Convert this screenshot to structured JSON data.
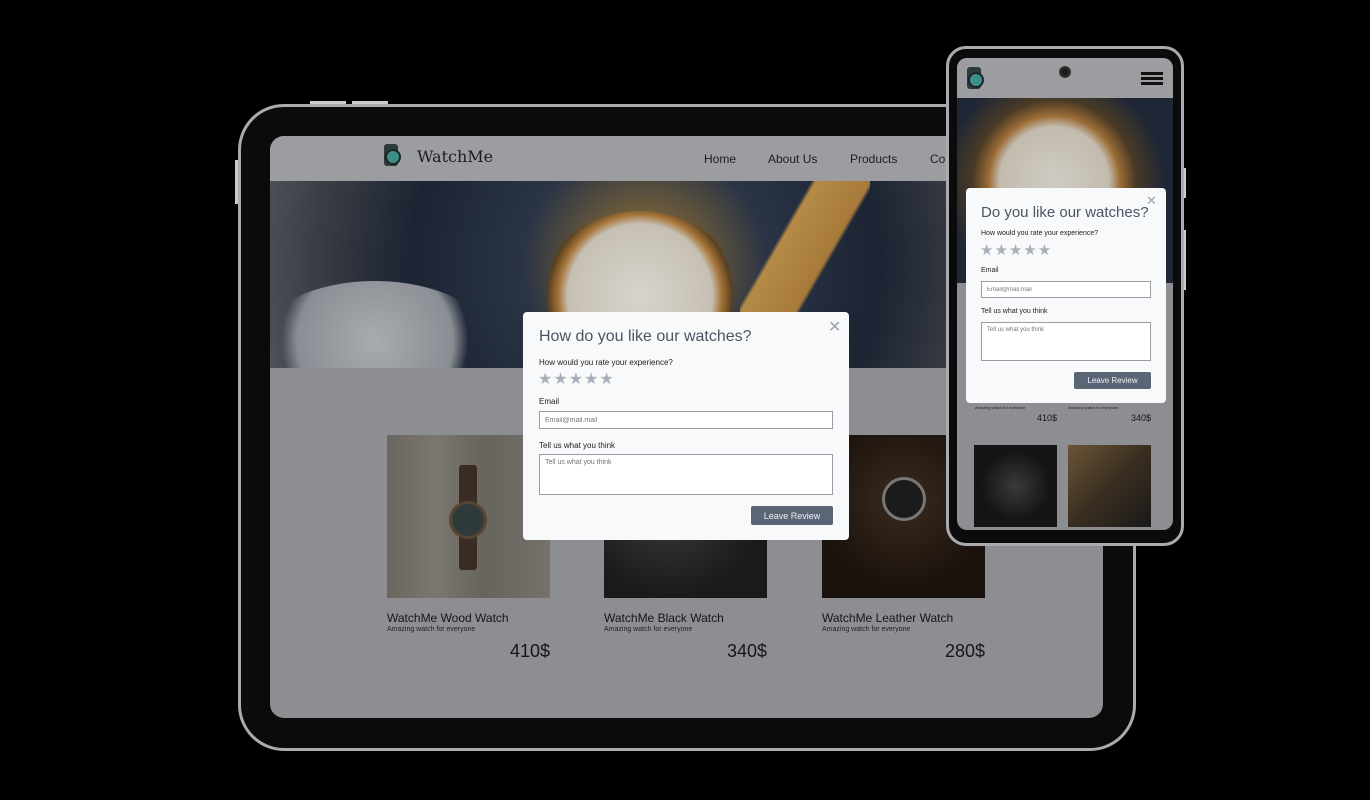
{
  "site": {
    "brand": "WatchMe",
    "nav": [
      "Home",
      "About Us",
      "Products",
      "Co"
    ]
  },
  "products": [
    {
      "title": "WatchMe Wood Watch",
      "subtitle": "Amazing watch for everyone",
      "price": "410$"
    },
    {
      "title": "WatchMe Black Watch",
      "subtitle": "Amazing watch for everyone",
      "price": "340$"
    },
    {
      "title": "WatchMe Leather Watch",
      "subtitle": "Amazing watch for everyone",
      "price": "280$"
    }
  ],
  "tablet_modal": {
    "title": "How do you like our watches?",
    "rating_label": "How would you rate your experience?",
    "stars": "★★★★★",
    "email_label": "Email",
    "email_placeholder": "Email@mail.mail",
    "comment_label": "Tell us what you think",
    "comment_placeholder": "Tell us what you think",
    "submit": "Leave Review",
    "close": "✕",
    "rating": 0
  },
  "phone_modal": {
    "title": "Do you like our watches?",
    "rating_label": "How would you rate your experience?",
    "stars": "★★★★★",
    "email_label": "Email",
    "email_placeholder": "Email@mail.mail",
    "comment_label": "Tell us what you think",
    "comment_placeholder": "Tell us what you think",
    "submit": "Leave Review",
    "close": "✕",
    "rating": 0
  },
  "phone_products": [
    {
      "subtitle": "Amazing watch for everyone",
      "price": "410$"
    },
    {
      "subtitle": "Amazing watch for everyone",
      "price": "340$"
    }
  ],
  "colors": {
    "button": "#5a6576",
    "star": "#a9b0bb",
    "modal_bg": "#f7f9fb"
  }
}
